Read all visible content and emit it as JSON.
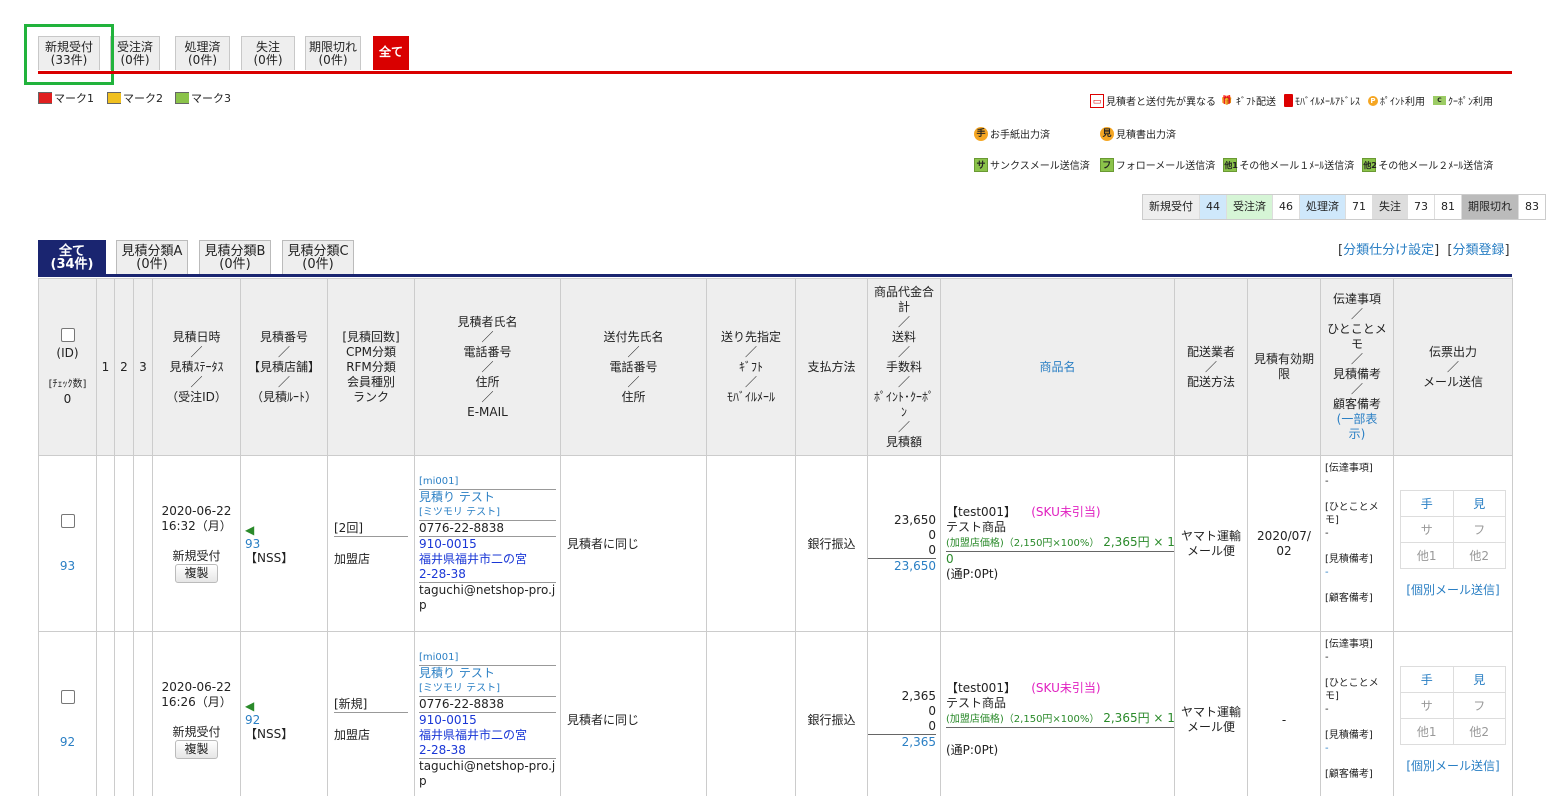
{
  "status_tabs": [
    {
      "label": "新規受付",
      "count": "(33件)"
    },
    {
      "label": "受注済",
      "count": "(0件)"
    },
    {
      "label": "処理済",
      "count": "(0件)"
    },
    {
      "label": "失注",
      "count": "(0件)"
    },
    {
      "label": "期限切れ",
      "count": "(0件)"
    },
    {
      "label": "全て",
      "count": ""
    }
  ],
  "marks": [
    "マーク1",
    "マーク2",
    "マーク3"
  ],
  "mark_colors": [
    "#e02020",
    "#f0c020",
    "#8bc34a"
  ],
  "legend": {
    "row1": [
      "見積者と送付先が異なる",
      "ｷﾞﾌﾄ配送",
      "ﾓﾊﾞｲﾙﾒｰﾙｱﾄﾞﾚｽ",
      "ﾎﾟｲﾝﾄ利用",
      "ｸｰﾎﾟﾝ利用"
    ],
    "row2": [
      "お手紙出力済",
      "見積書出力済"
    ],
    "row2_icons": [
      "手",
      "見"
    ],
    "row3": [
      "サンクスメール送信済",
      "フォローメール送信済",
      "その他メール１ﾒｰﾙ送信済",
      "その他メール２ﾒｰﾙ送信済"
    ],
    "row3_icons": [
      "サ",
      "フ",
      "他1",
      "他2"
    ]
  },
  "counts": [
    {
      "label": "新規受付",
      "value": "44",
      "bg": "#eee"
    },
    {
      "label": "受注済",
      "value": "46",
      "bg": "#d6f5d6"
    },
    {
      "label": "処理済",
      "value": "71",
      "bg": "#cfe8fb"
    },
    {
      "label": "失注",
      "value": "73",
      "bg": "#ddd"
    },
    {
      "label": "",
      "value": "81",
      "bg": "#fff"
    },
    {
      "label": "期限切れ",
      "value": "83",
      "bg": "#bbb"
    }
  ],
  "cat_tabs": [
    {
      "label": "全て",
      "count": "(34件)"
    },
    {
      "label": "見積分類A",
      "count": "(0件)"
    },
    {
      "label": "見積分類B",
      "count": "(0件)"
    },
    {
      "label": "見積分類C",
      "count": "(0件)"
    }
  ],
  "links": {
    "setting": "分類仕分け設定",
    "register": "分類登録"
  },
  "headers": {
    "id": "(ID)",
    "check": "[ﾁｪｯｸ数]",
    "check_count": "0",
    "m1": "1",
    "m2": "2",
    "m3": "3",
    "date": [
      "見積日時",
      "／",
      "見積ｽﾃｰﾀｽ",
      "／",
      "（受注ID）"
    ],
    "num": [
      "見積番号",
      "／",
      "【見積店舗】",
      "／",
      "（見積ﾙｰﾄ）"
    ],
    "count": [
      "[見積回数]",
      "CPM分類",
      "RFM分類",
      "会員種別",
      "ランク"
    ],
    "name": [
      "見積者氏名",
      "／",
      "電話番号",
      "／",
      "住所",
      "／",
      "E-MAIL"
    ],
    "dest": [
      "送付先氏名",
      "／",
      "電話番号",
      "／",
      "住所"
    ],
    "spec": [
      "送り先指定",
      "／",
      "ｷﾞﾌﾄ",
      "／",
      "ﾓﾊﾞｲﾙﾒｰﾙ"
    ],
    "pay": "支払方法",
    "amount": [
      "商品代金合",
      "計",
      "／",
      "送料",
      "／",
      "手数料",
      "／",
      "ﾎﾟｲﾝﾄ･ｸｰﾎﾟ",
      "ﾝ",
      "／",
      "見積額"
    ],
    "product": "商品名",
    "ship": [
      "配送業者",
      "／",
      "配送方法"
    ],
    "expire": [
      "見積有効期",
      "限"
    ],
    "memo": [
      "伝達事項",
      "／",
      "ひとことメ",
      "モ",
      "／",
      "見積備考",
      "／",
      "顧客備考",
      "(一部表",
      "示)"
    ],
    "out": [
      "伝票出力",
      "／",
      "メール送信"
    ]
  },
  "rows": [
    {
      "id": "93",
      "date": "2020-06-22",
      "time": "16:32（月）",
      "status": "新規受付",
      "copy": "複製",
      "num": "93",
      "shop": "【NSS】",
      "visits": "[2回]",
      "member": "加盟店",
      "cid": "[mi001]",
      "name": "見積り テスト",
      "kana": "[ミツモリ テスト]",
      "tel": "0776-22-8838",
      "zip": "910-0015",
      "addr1": "福井県福井市二の宮",
      "addr2": "2-28-38",
      "mail1": "taguchi@netshop-pro.j",
      "mail2": "p",
      "dest": "見積者に同じ",
      "pay": "銀行振込",
      "subtotal": "23,650",
      "ship": "0",
      "fee": "0",
      "total": "23,650",
      "pcode": "【test001】",
      "sku": "(SKU未引当)",
      "pname": "テスト商品",
      "price_note": "(加盟店価格)（2,150円×100%）",
      "price": "2,365円 × 1",
      "price_qty": "0",
      "pt": "(通P:0Pt)",
      "carrier": "ヤマト運輸",
      "method": "メール便",
      "expire": "2020/07/",
      "expire2": "02",
      "memo_labels": [
        "[伝達事項]",
        "-",
        "[ひとことメ",
        "モ]",
        "-",
        "[見積備考]",
        "-",
        "[顧客備考]"
      ],
      "btns": [
        "手",
        "見",
        "サ",
        "フ",
        "他1",
        "他2"
      ],
      "mail": "[個別メール送信]"
    },
    {
      "id": "92",
      "date": "2020-06-22",
      "time": "16:26（月）",
      "status": "新規受付",
      "copy": "複製",
      "num": "92",
      "shop": "【NSS】",
      "visits": "[新規]",
      "member": "加盟店",
      "cid": "[mi001]",
      "name": "見積り テスト",
      "kana": "[ミツモリ テスト]",
      "tel": "0776-22-8838",
      "zip": "910-0015",
      "addr1": "福井県福井市二の宮",
      "addr2": "2-28-38",
      "mail1": "taguchi@netshop-pro.j",
      "mail2": "p",
      "dest": "見積者に同じ",
      "pay": "銀行振込",
      "subtotal": "2,365",
      "ship": "0",
      "fee": "0",
      "total": "2,365",
      "pcode": "【test001】",
      "sku": "(SKU未引当)",
      "pname": "テスト商品",
      "price_note": "(加盟店価格)（2,150円×100%）",
      "price": "2,365円 × 1",
      "price_qty": "",
      "pt": "(通P:0Pt)",
      "carrier": "ヤマト運輸",
      "method": "メール便",
      "expire": "-",
      "expire2": "",
      "memo_labels": [
        "[伝達事項]",
        "-",
        "[ひとことメ",
        "モ]",
        "-",
        "[見積備考]",
        "-",
        "[顧客備考]"
      ],
      "btns": [
        "手",
        "見",
        "サ",
        "フ",
        "他1",
        "他2"
      ],
      "mail": "[個別メール送信]"
    }
  ]
}
